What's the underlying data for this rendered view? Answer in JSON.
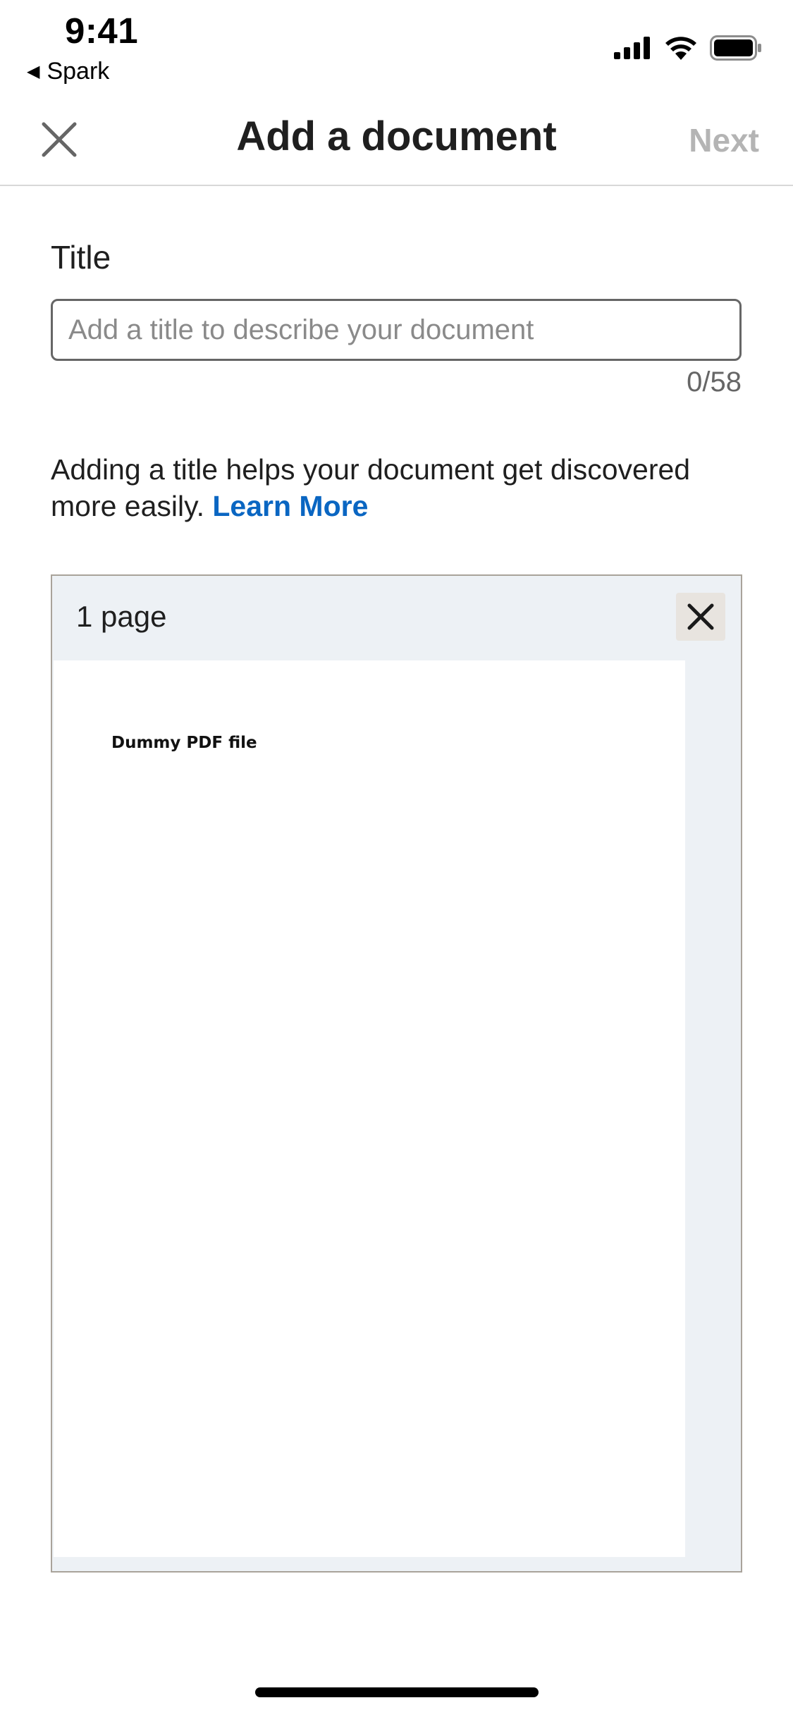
{
  "status_bar": {
    "time": "9:41",
    "back_app": "Spark",
    "icons": [
      "cellular-signal-icon",
      "wifi-icon",
      "battery-icon"
    ]
  },
  "nav": {
    "title": "Add a document",
    "next_label": "Next",
    "close_icon": "close-icon"
  },
  "form": {
    "title_label": "Title",
    "title_placeholder": "Add a title to describe your document",
    "title_value": "",
    "char_count": "0/58",
    "helper_text": "Adding a title helps your document get discovered more easily.",
    "learn_more": "Learn More"
  },
  "document": {
    "page_count": "1 page",
    "page_heading": "Dummy PDF file",
    "remove_icon": "close-icon"
  },
  "colors": {
    "link": "#0a66c2",
    "next_disabled": "#b4b4b4",
    "card_background": "#edf1f5"
  }
}
